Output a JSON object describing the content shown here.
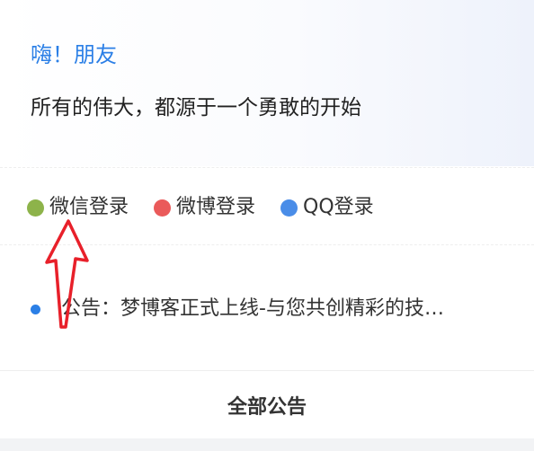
{
  "welcome": {
    "greeting": "嗨！朋友",
    "motto": "所有的伟大，都源于一个勇敢的开始"
  },
  "login": {
    "items": [
      {
        "label": "微信登录",
        "color": "#8db34a",
        "icon": "wechat-dot-icon"
      },
      {
        "label": "微博登录",
        "color": "#ea5a5a",
        "icon": "weibo-dot-icon"
      },
      {
        "label": "QQ登录",
        "color": "#4a8de8",
        "icon": "qq-dot-icon"
      }
    ]
  },
  "notice": {
    "text": "公告：梦博客正式上线-与您共创精彩的技…",
    "dot_color": "#2b7fe6"
  },
  "footer": {
    "all_notices_label": "全部公告"
  },
  "colors": {
    "accent": "#2b7fe6",
    "annotation_arrow": "#e8202a"
  },
  "annotation": {
    "icon": "red-arrow-pointing-up-icon"
  }
}
